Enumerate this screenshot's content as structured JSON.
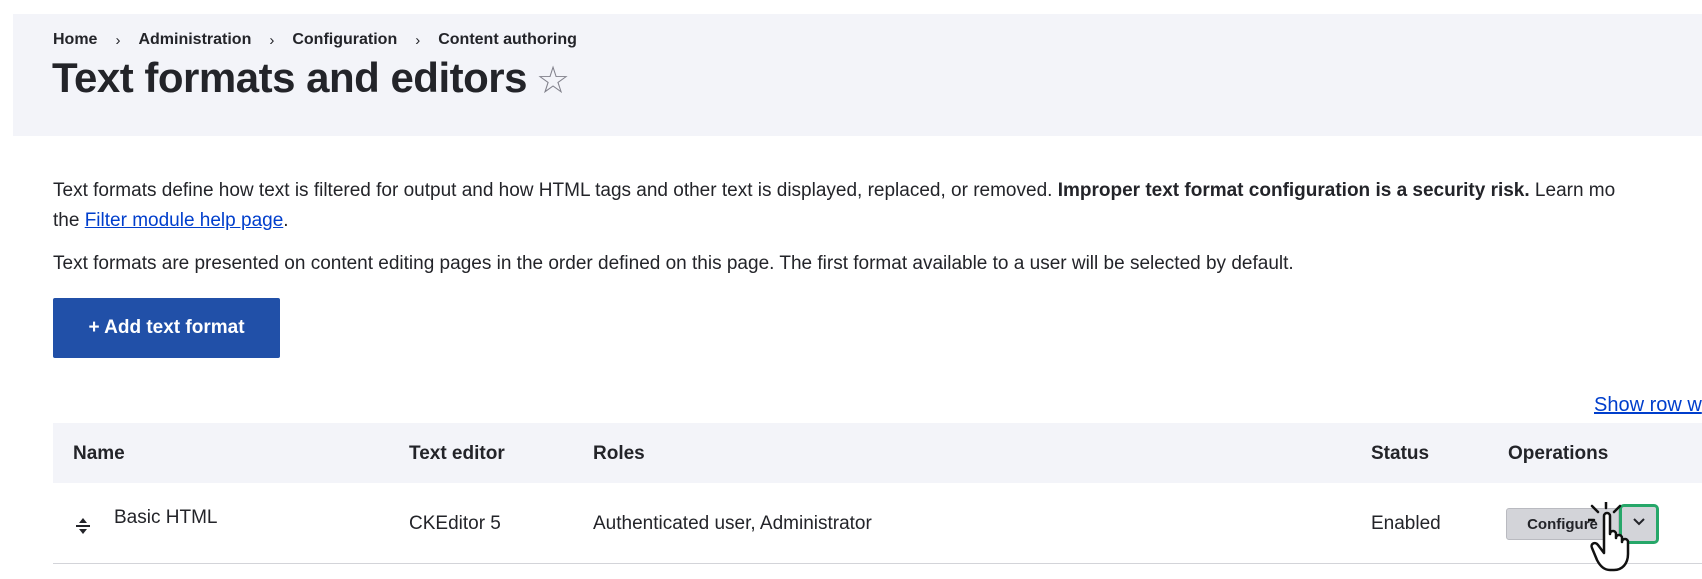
{
  "breadcrumb": {
    "items": [
      "Home",
      "Administration",
      "Configuration",
      "Content authoring"
    ],
    "separator": "›"
  },
  "page": {
    "title": "Text formats and editors",
    "favorite_icon": "star-outline-icon"
  },
  "description": {
    "p1_text": "Text formats define how text is filtered for output and how HTML tags and other text is displayed, replaced, or removed. ",
    "p1_bold": "Improper text format configuration is a security risk.",
    "p1_tail": " Learn mo",
    "p1_line2_prefix": "the ",
    "p1_link": "Filter module help page",
    "p1_line2_suffix": ".",
    "p2": "Text formats are presented on content editing pages in the order defined on this page. The first format available to a user will be selected by default."
  },
  "actions": {
    "add_label": "+ Add text format",
    "show_row_weights": "Show row w"
  },
  "table": {
    "headers": {
      "name": "Name",
      "editor": "Text editor",
      "roles": "Roles",
      "status": "Status",
      "operations": "Operations"
    },
    "rows": [
      {
        "name": "Basic HTML",
        "editor": "CKEditor 5",
        "roles": "Authenticated user, Administrator",
        "status": "Enabled",
        "operation": "Configure"
      }
    ]
  },
  "colors": {
    "primary_button": "#2150a8",
    "link": "#003ecc",
    "header_band": "#f3f4f9",
    "focus_ring": "#26a769"
  }
}
